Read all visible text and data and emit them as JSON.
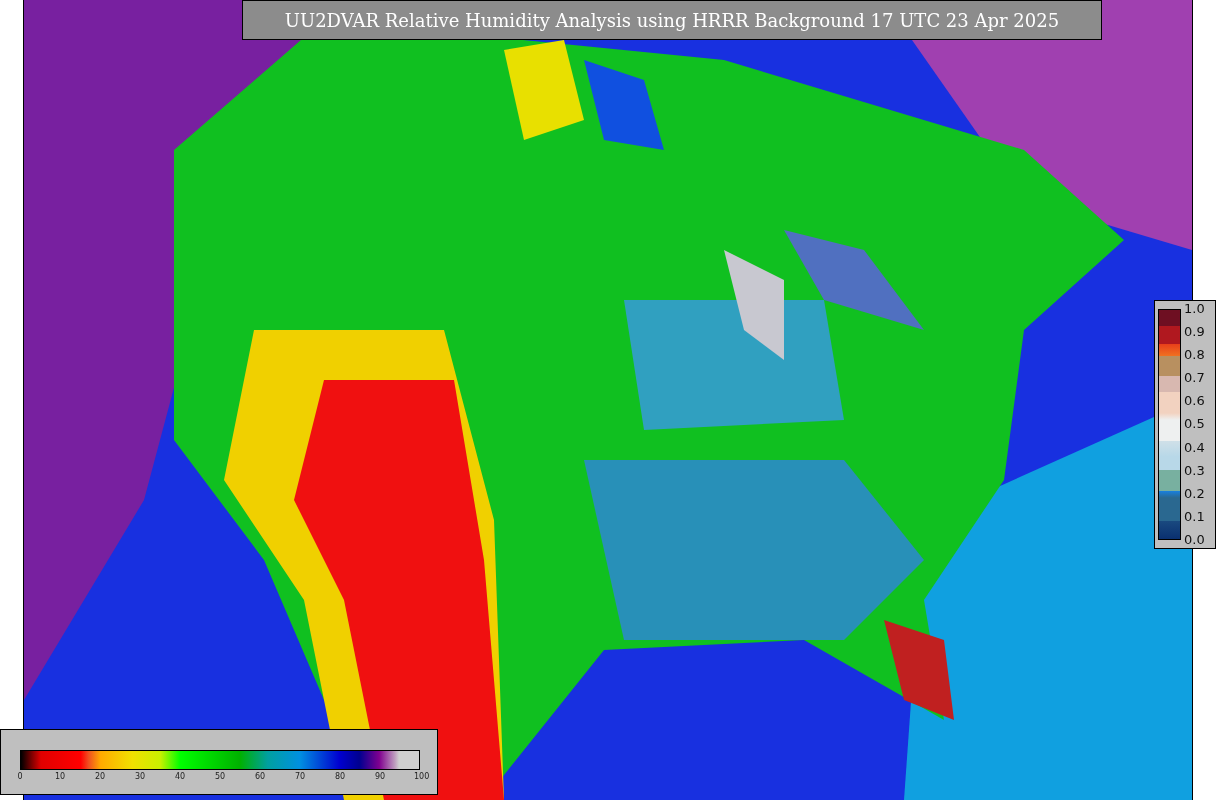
{
  "title": "UU2DVAR Relative Humidity Analysis using HRRR Background 17 UTC 23 Apr 2025",
  "weight_colorbar": {
    "ticks": [
      "1.0",
      "0.9",
      "0.8",
      "0.7",
      "0.6",
      "0.5",
      "0.4",
      "0.3",
      "0.2",
      "0.1",
      "0.0"
    ]
  },
  "humidity_colorbar": {
    "ticks": [
      "0",
      "10",
      "20",
      "30",
      "40",
      "50",
      "60",
      "70",
      "80",
      "90",
      "100"
    ]
  }
}
